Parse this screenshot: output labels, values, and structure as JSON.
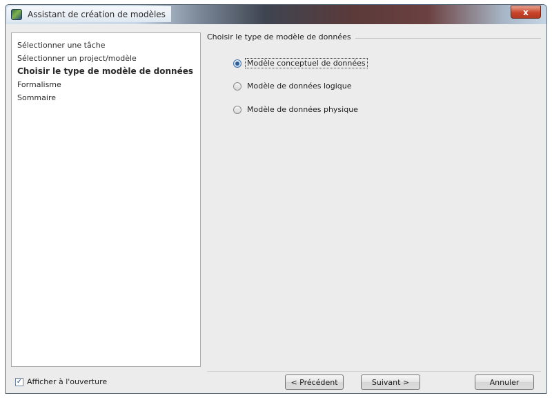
{
  "window": {
    "title": "Assistant de création de modèles",
    "close_label": "x"
  },
  "steps": [
    {
      "label": "Sélectionner une tâche",
      "current": false
    },
    {
      "label": "Sélectionner un project/modèle",
      "current": false
    },
    {
      "label": "Choisir le type de modèle de données",
      "current": true
    },
    {
      "label": "Formalisme",
      "current": false
    },
    {
      "label": "Sommaire",
      "current": false
    }
  ],
  "group": {
    "title": "Choisir le type de modèle de données",
    "options": [
      {
        "label": "Modèle conceptuel de données",
        "selected": true
      },
      {
        "label": "Modèle de données logique",
        "selected": false
      },
      {
        "label": "Modèle de données physique",
        "selected": false
      }
    ]
  },
  "footer": {
    "show_on_open_label": "Afficher à l'ouverture",
    "show_on_open_checked": true,
    "check_mark": "✓",
    "prev_label": "< Précédent",
    "next_label": "Suivant >",
    "cancel_label": "Annuler"
  }
}
